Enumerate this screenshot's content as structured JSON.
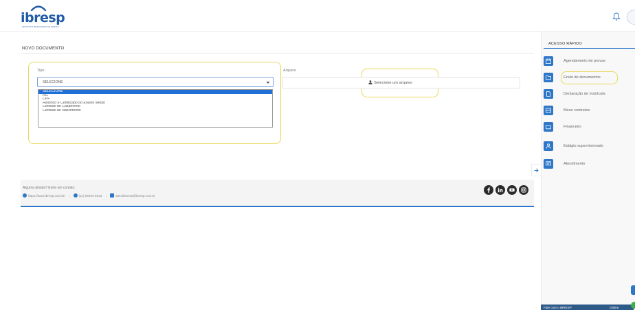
{
  "brand": {
    "logo_text": "ibresp",
    "logo_tagline": "INSTITUTO BRASILEIRO DE ENSINO",
    "primary_color": "#2e77c8",
    "logo_color": "#1f5aa6",
    "highlight_color": "#e8d95a"
  },
  "header": {
    "bell_icon": "bell-icon",
    "avatar_icon": "avatar"
  },
  "main": {
    "title": "NOVO DOCUMENTO",
    "tipo": {
      "label": "Tipo",
      "value": "SELECIONE",
      "options": [
        "SELECIONE",
        "RG",
        "CPF",
        "Histórico e Certificado do Ensino Médio",
        "Certidão de Casamento",
        "Certidão de Nascimento"
      ],
      "selected_index": 0
    },
    "arquivo": {
      "label": "Arquivo",
      "button_label": "Selecione um arquivo"
    }
  },
  "footer": {
    "question": "Alguma dúvida? Entre em contato:",
    "website": "https://www.ibresp.com.br/",
    "phone": "(11) 99494-9033",
    "email": "atendimento@ibresp.com.br",
    "socials": [
      "facebook-icon",
      "linkedin-icon",
      "youtube-icon",
      "instagram-icon"
    ]
  },
  "sidebar": {
    "title": "ACESSO RÁPIDO",
    "items": [
      {
        "label": "Agendamento de provas",
        "icon": "calendar-icon"
      },
      {
        "label": "Envio de documentos",
        "icon": "folder-icon"
      },
      {
        "label": "Declaração de matrícula",
        "icon": "document-icon"
      },
      {
        "label": "Meus contratos",
        "icon": "contract-icon"
      },
      {
        "label": "Financeiro",
        "icon": "folder-icon"
      },
      {
        "label": "Estágio supervisionado",
        "icon": "user-icon"
      },
      {
        "label": "Atendimento",
        "icon": "chat-icon"
      }
    ]
  },
  "chat": {
    "label": "Fale com o IBRESP",
    "status": "Online"
  }
}
